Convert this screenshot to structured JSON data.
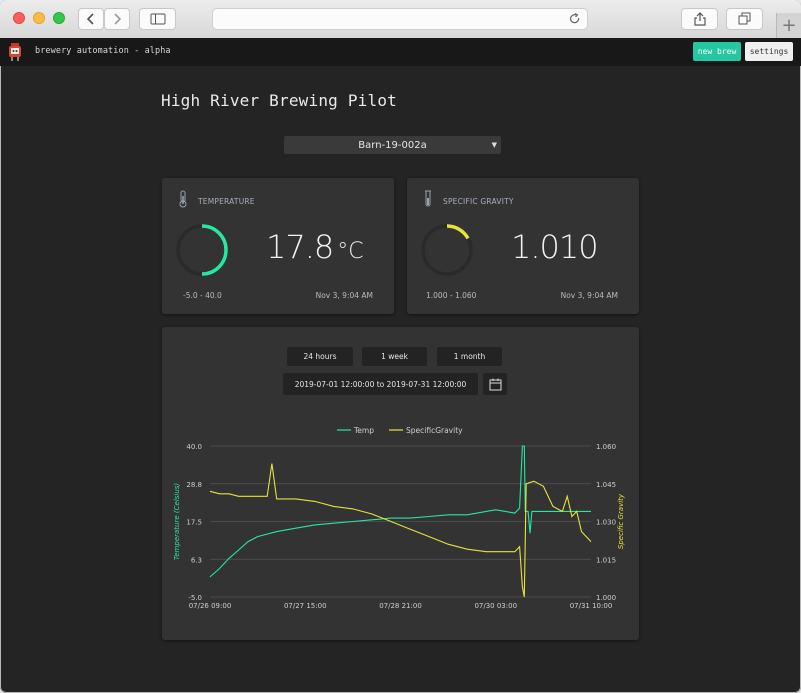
{
  "app": {
    "title": "brewery automation - alpha",
    "new_brew_label": "new brew",
    "settings_label": "settings"
  },
  "browser": {
    "plus_tab": "+"
  },
  "page": {
    "title": "High River Brewing Pilot",
    "selected_batch": "Barn-19-002a"
  },
  "temperature_card": {
    "title": "TEMPERATURE",
    "value": "17.8",
    "unit": "°C",
    "range": "-5.0 - 40.0",
    "timestamp": "Nov 3, 9:04 AM",
    "gauge_fraction": 0.5,
    "gauge_color": "#26e8a0"
  },
  "gravity_card": {
    "title": "SPECIFIC GRAVITY",
    "value": "1.010",
    "range": "1.000 - 1.060",
    "timestamp": "Nov 3, 9:04 AM",
    "gauge_fraction": 0.17,
    "gauge_color": "#e8e23c"
  },
  "controls": {
    "ranges": [
      "24 hours",
      "1 week",
      "1 month"
    ],
    "date_range": "2019-07-01 12:00:00 to 2019-07-31 12:00:00",
    "calendar_icon": "calendar-icon"
  },
  "chart_data": {
    "type": "line",
    "legend": [
      "Temp",
      "SpecificGravity"
    ],
    "legend_position": "top-center",
    "grid": true,
    "x_ticks": [
      "07/26 09:00",
      "07/27 15:00",
      "07/28 21:00",
      "07/30 03:00",
      "07/31 10:00"
    ],
    "x_range": [
      0,
      4
    ],
    "y_left": {
      "label": "Temperature (Celsius)",
      "ticks": [
        "40.0",
        "28.8",
        "17.5",
        "6.3",
        "-5.0"
      ],
      "range": [
        -5.0,
        40.0
      ]
    },
    "y_right": {
      "label": "Specific Gravity",
      "ticks": [
        "1.060",
        "1.045",
        "1.030",
        "1.015",
        "1.000"
      ],
      "range": [
        1.0,
        1.06
      ]
    },
    "series": [
      {
        "name": "Temp",
        "axis": "left",
        "color": "#26e8a0",
        "points": [
          [
            0.0,
            1.0
          ],
          [
            0.1,
            3.5
          ],
          [
            0.2,
            6.5
          ],
          [
            0.3,
            9.0
          ],
          [
            0.4,
            11.5
          ],
          [
            0.5,
            13.0
          ],
          [
            0.7,
            14.5
          ],
          [
            0.9,
            15.5
          ],
          [
            1.1,
            16.5
          ],
          [
            1.3,
            17.0
          ],
          [
            1.5,
            17.5
          ],
          [
            1.7,
            18.0
          ],
          [
            1.9,
            18.5
          ],
          [
            2.1,
            18.5
          ],
          [
            2.3,
            19.0
          ],
          [
            2.5,
            19.5
          ],
          [
            2.7,
            19.5
          ],
          [
            2.9,
            20.5
          ],
          [
            3.0,
            21.0
          ],
          [
            3.1,
            20.5
          ],
          [
            3.2,
            20.0
          ],
          [
            3.25,
            21.5
          ],
          [
            3.28,
            40.0
          ],
          [
            3.3,
            40.0
          ],
          [
            3.31,
            20.5
          ],
          [
            3.34,
            20.5
          ],
          [
            3.36,
            14.0
          ],
          [
            3.38,
            20.5
          ],
          [
            3.6,
            20.5
          ],
          [
            3.8,
            20.5
          ],
          [
            4.0,
            20.5
          ]
        ]
      },
      {
        "name": "SpecificGravity",
        "axis": "right",
        "color": "#e8e23c",
        "points": [
          [
            0.0,
            1.042
          ],
          [
            0.1,
            1.041
          ],
          [
            0.2,
            1.041
          ],
          [
            0.3,
            1.04
          ],
          [
            0.6,
            1.04
          ],
          [
            0.65,
            1.053
          ],
          [
            0.7,
            1.039
          ],
          [
            0.9,
            1.039
          ],
          [
            1.1,
            1.038
          ],
          [
            1.3,
            1.036
          ],
          [
            1.5,
            1.035
          ],
          [
            1.7,
            1.033
          ],
          [
            1.9,
            1.03
          ],
          [
            2.1,
            1.027
          ],
          [
            2.3,
            1.024
          ],
          [
            2.5,
            1.021
          ],
          [
            2.7,
            1.019
          ],
          [
            2.9,
            1.018
          ],
          [
            3.0,
            1.018
          ],
          [
            3.1,
            1.018
          ],
          [
            3.2,
            1.018
          ],
          [
            3.25,
            1.02
          ],
          [
            3.28,
            1.004
          ],
          [
            3.3,
            1.0
          ],
          [
            3.32,
            1.045
          ],
          [
            3.4,
            1.046
          ],
          [
            3.5,
            1.044
          ],
          [
            3.6,
            1.036
          ],
          [
            3.7,
            1.034
          ],
          [
            3.75,
            1.04
          ],
          [
            3.8,
            1.032
          ],
          [
            3.85,
            1.034
          ],
          [
            3.9,
            1.026
          ],
          [
            4.0,
            1.022
          ]
        ]
      }
    ]
  }
}
